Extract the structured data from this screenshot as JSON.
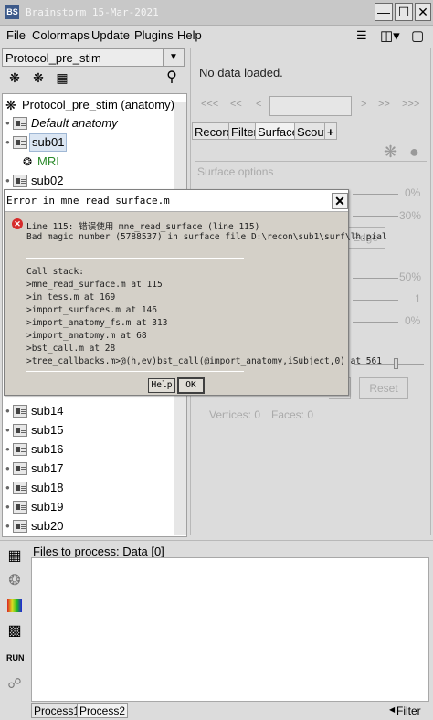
{
  "window": {
    "title": "Brainstorm 15-Mar-2021",
    "logo": "BS",
    "controls": [
      "minimize-icon",
      "maximize-icon",
      "close-icon"
    ]
  },
  "menu": [
    "File",
    "Colormaps",
    "Update",
    "Plugins",
    "Help"
  ],
  "menu_icons": [
    "list-icon",
    "layout-icon",
    "window-icon"
  ],
  "protocol": {
    "selected": "Protocol_pre_stim",
    "toolbar_icons": [
      "anatomy-view-icon",
      "functional-view-icon",
      "group-view-icon",
      "search-icon"
    ]
  },
  "tree": {
    "root": "Protocol_pre_stim (anatomy)",
    "default_anatomy": "Default anatomy",
    "sub01": "sub01",
    "mri": "MRI",
    "sub02": "sub02",
    "subjects_bottom": [
      "sub14",
      "sub15",
      "sub16",
      "sub17",
      "sub18",
      "sub19",
      "sub20"
    ]
  },
  "right_panel": {
    "no_data": "No data loaded.",
    "nav": [
      "<<<",
      "<<",
      "<",
      ">",
      ">>",
      ">>>"
    ],
    "tabs": [
      "Record",
      "Filter",
      "Surface",
      "Scout",
      "+"
    ],
    "active_tab": "Surface",
    "surface_options": "Surface options",
    "values": [
      "0%",
      "30%",
      "50%",
      "1",
      "0%"
    ],
    "edge_button": "Edge",
    "reset_button": "Reset",
    "vertices": "Vertices: 0",
    "faces": "Faces: 0"
  },
  "dialog": {
    "title": "Error in mne_read_surface.m",
    "line1": "Line 115: 错误使用 mne_read_surface (line 115)",
    "line2": "Bad magic number (5788537) in surface file D:\\recon\\sub1\\surf\\lh.pial",
    "call_stack_label": "Call stack:",
    "stack": [
      ">mne_read_surface.m at 115",
      ">in_tess.m at 169",
      ">import_surfaces.m at 146",
      ">import_anatomy_fs.m at 313",
      ">import_anatomy.m at 68",
      ">bst_call.m at 28",
      ">tree_callbacks.m>@(h,ev)bst_call(@import_anatomy,iSubject,0) at 561"
    ],
    "help_button": "Help",
    "ok_button": "OK"
  },
  "process": {
    "files_header": "Files to process: Data [0]",
    "sidebar_icons": [
      "data-icon",
      "sources-icon",
      "timefreq-icon",
      "matrix-icon",
      "run-icon",
      "link-icon"
    ],
    "run_label": "RUN",
    "tabs": [
      "Process1",
      "Process2"
    ],
    "filter": "Filter"
  }
}
